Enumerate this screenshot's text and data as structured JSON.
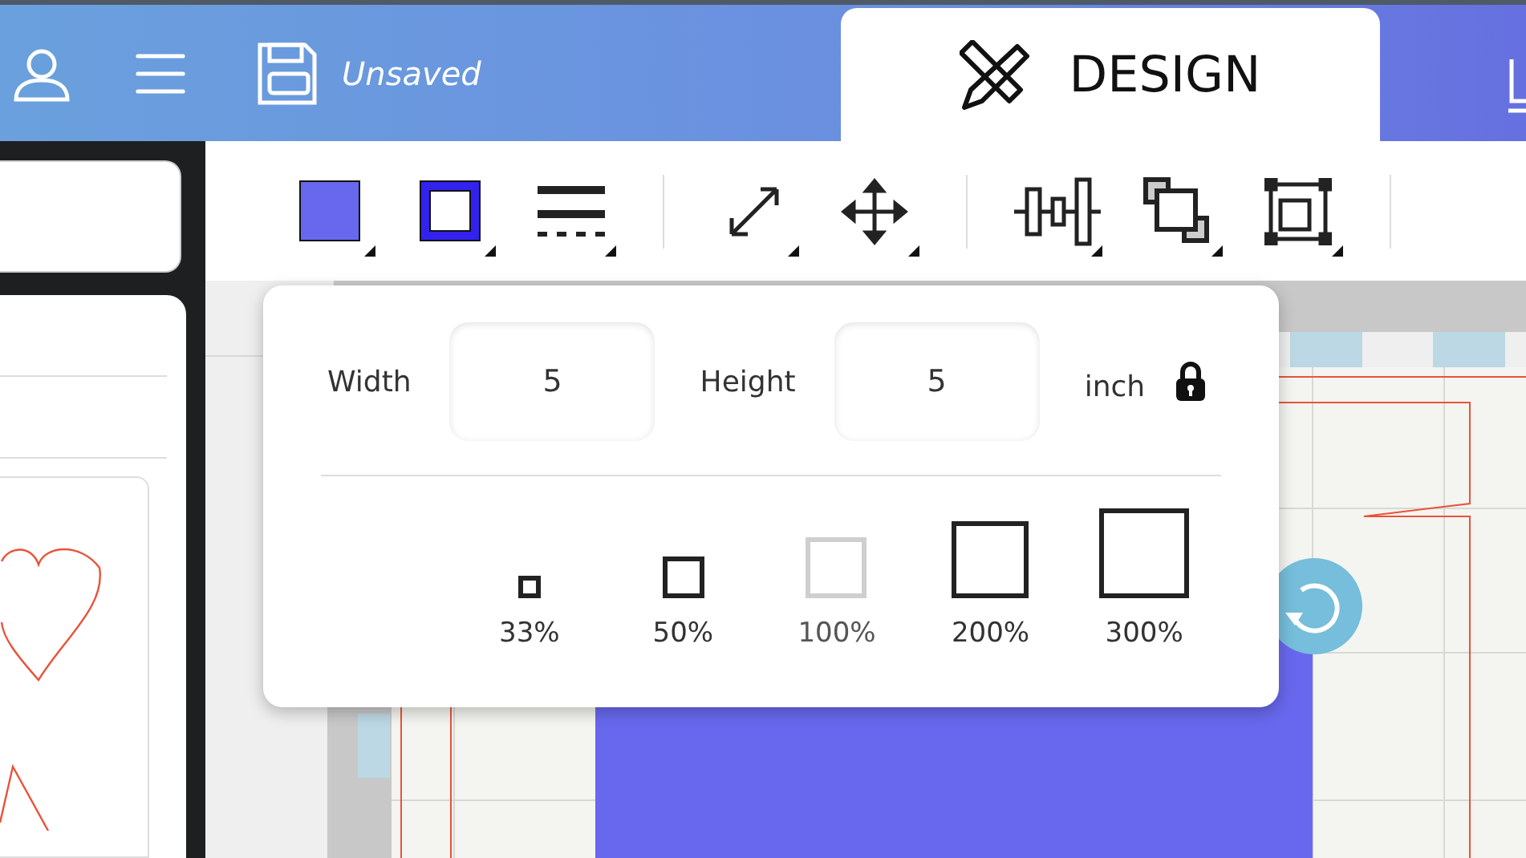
{
  "header": {
    "save_status": "Unsaved"
  },
  "tabs": [
    {
      "label": "DESIGN",
      "selected": true
    }
  ],
  "size_popover": {
    "width_label": "Width",
    "width_value": "5",
    "height_label": "Height",
    "height_value": "5",
    "unit": "inch",
    "scale_options": [
      {
        "label": "33%",
        "disabled": false
      },
      {
        "label": "50%",
        "disabled": false
      },
      {
        "label": "100%",
        "disabled": true
      },
      {
        "label": "200%",
        "disabled": false
      },
      {
        "label": "300%",
        "disabled": false
      }
    ]
  }
}
